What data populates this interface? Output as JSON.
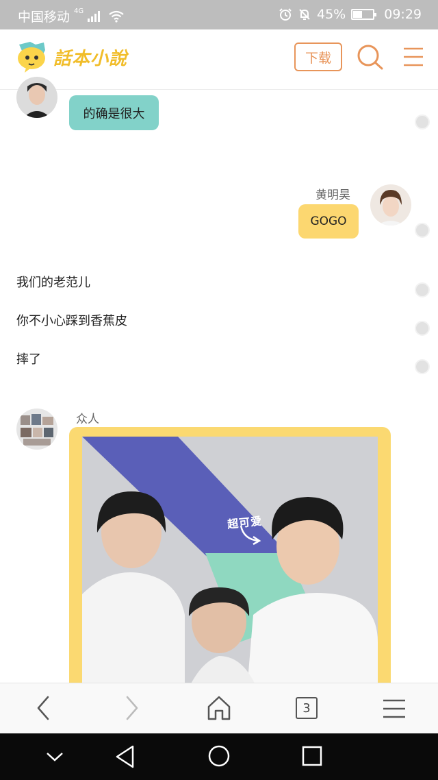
{
  "status": {
    "carrier": "中国移动",
    "network": "4G",
    "battery": "45%",
    "battery_level": 0.45,
    "time": "09:29"
  },
  "header": {
    "logo_text": "話本小說",
    "download_label": "下载"
  },
  "messages": [
    {
      "type": "bubble-left",
      "text": "的确是很大",
      "bubble_color": "#82d2c9"
    },
    {
      "type": "bubble-right",
      "name": "黄明昊",
      "text": "GOGO",
      "bubble_color": "#fcd770"
    },
    {
      "type": "narration",
      "text": "我们的老范儿"
    },
    {
      "type": "narration",
      "text": "你不小心踩到香蕉皮"
    },
    {
      "type": "narration",
      "text": "摔了"
    },
    {
      "type": "image-left",
      "name": "众人",
      "sticker_text": "超可爱",
      "frame_color": "#fbd971"
    }
  ],
  "bottom": {
    "tab_count": "3"
  },
  "colors": {
    "accent": "#e8955a",
    "status_bar": "#bdbdbd"
  }
}
